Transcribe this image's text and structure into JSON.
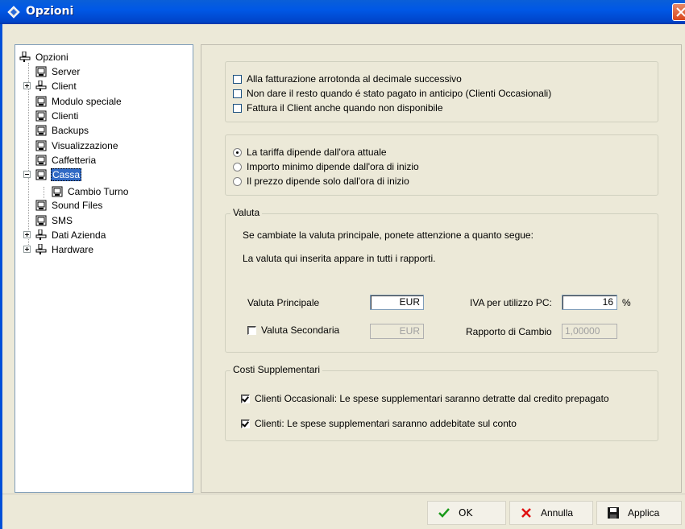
{
  "window": {
    "title": "Opzioni"
  },
  "tree": {
    "items": [
      {
        "label": "Opzioni",
        "icon": "computer-icon"
      },
      {
        "label": "Server",
        "icon": "page-icon"
      },
      {
        "label": "Client",
        "icon": "computer-icon"
      },
      {
        "label": "Modulo speciale",
        "icon": "page-icon"
      },
      {
        "label": "Clienti",
        "icon": "page-icon"
      },
      {
        "label": "Backups",
        "icon": "page-icon"
      },
      {
        "label": "Visualizzazione",
        "icon": "page-icon"
      },
      {
        "label": "Caffetteria",
        "icon": "page-icon"
      },
      {
        "label": "Cassa",
        "icon": "page-icon",
        "selected": true
      },
      {
        "label": "Cambio Turno",
        "icon": "page-icon"
      },
      {
        "label": "Sound Files",
        "icon": "page-icon"
      },
      {
        "label": "SMS",
        "icon": "page-icon"
      },
      {
        "label": "Dati Azienda",
        "icon": "computer-icon"
      },
      {
        "label": "Hardware",
        "icon": "computer-icon"
      }
    ]
  },
  "billing": {
    "checkboxes": [
      {
        "label": "Alla fatturazione arrotonda al decimale successivo",
        "checked": false
      },
      {
        "label": "Non dare il resto quando é stato pagato in anticipo (Clienti Occasionali)",
        "checked": false
      },
      {
        "label": "Fattura il Client anche quando non disponibile",
        "checked": false
      }
    ]
  },
  "tariff": {
    "radios": [
      {
        "label": "La tariffa dipende dall'ora attuale",
        "checked": true
      },
      {
        "label": "Importo minimo dipende dall'ora di inizio",
        "checked": false
      },
      {
        "label": "Il prezzo dipende solo dall'ora di inizio",
        "checked": false
      }
    ]
  },
  "valuta": {
    "title": "Valuta",
    "note1": "Se cambiate la valuta principale, ponete attenzione a quanto segue:",
    "note2": "La valuta qui inserita appare in tutti i rapporti.",
    "principale_label": "Valuta Principale",
    "principale_value": "EUR",
    "iva_label": "IVA per utilizzo PC:",
    "iva_value": "16",
    "iva_unit": "%",
    "secondaria_label": "Valuta Secondaria",
    "secondaria_checked": false,
    "secondaria_value": "EUR",
    "cambio_label": "Rapporto di Cambio",
    "cambio_value": "1,00000"
  },
  "costi": {
    "title": "Costi Supplementari",
    "checkboxes": [
      {
        "label": "Clienti Occasionali: Le spese supplementari saranno detratte dal credito prepagato",
        "checked": true
      },
      {
        "label": "Clienti: Le spese supplementari saranno addebitate sul conto",
        "checked": true
      }
    ]
  },
  "buttons": {
    "ok": "OK",
    "annulla": "Annulla",
    "applica": "Applica"
  },
  "colors": {
    "titlebar": "#0058e6",
    "selection": "#316ac5",
    "ok_icon": "#1a9a1a",
    "cancel_icon": "#e01010"
  }
}
